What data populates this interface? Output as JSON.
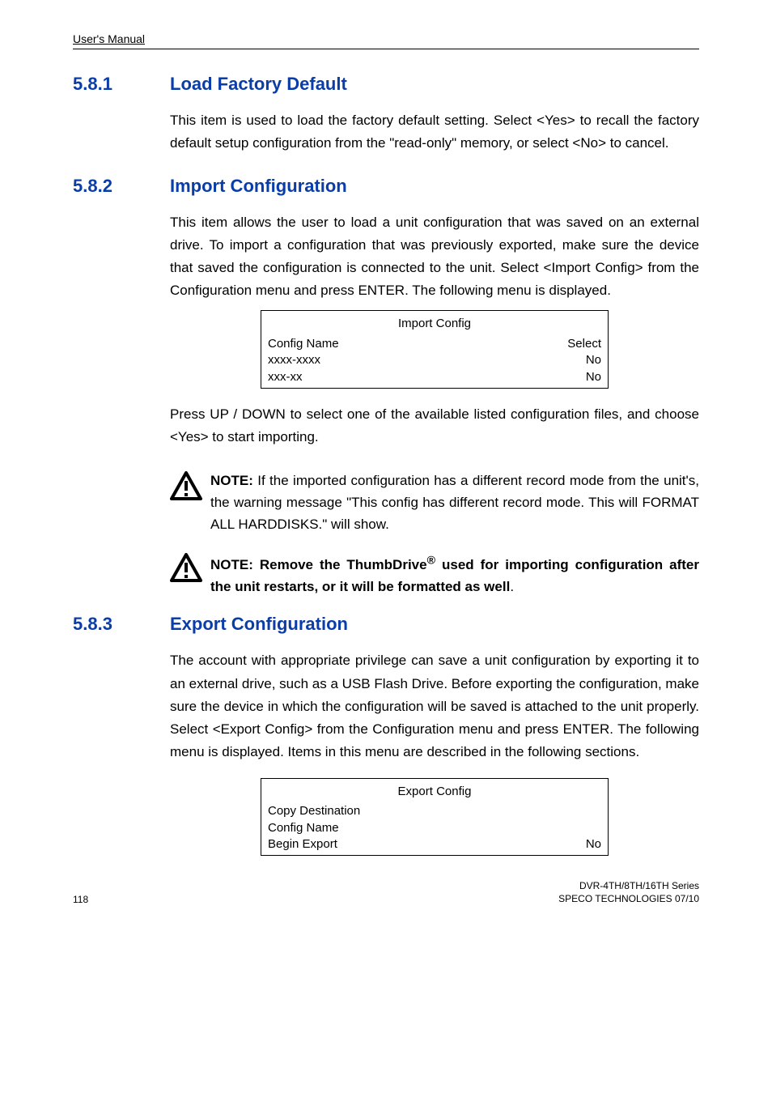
{
  "header": {
    "manual": "User's Manual"
  },
  "s581": {
    "num": "5.8.1",
    "title": "Load Factory Default",
    "body": "This item is used to load the factory default setting. Select <Yes> to recall the factory default setup configuration from the \"read-only\" memory, or select <No> to cancel."
  },
  "s582": {
    "num": "5.8.2",
    "title": "Import Configuration",
    "body1": "This item allows the user to load a unit configuration that was saved on an external drive. To import a configuration that was previously exported, make sure the device that saved the configuration is connected to the unit. Select <Import Config> from the Configuration menu and press ENTER. The following menu is displayed.",
    "table": {
      "title": "Import Config",
      "rows": [
        {
          "l": "Config Name",
          "r": "Select"
        },
        {
          "l": "xxxx-xxxx",
          "r": "No"
        },
        {
          "l": "xxx-xx",
          "r": "No"
        }
      ]
    },
    "body2": "Press UP / DOWN to select one of the available listed configuration files, and choose <Yes> to start importing.",
    "note1_label": "NOTE:",
    "note1_text": " If the imported configuration has a different record mode from the unit's, the warning message \"This config has different record mode. This will FORMAT ALL HARDDISKS.\" will show.",
    "note2_pre": "NOTE: Remove the ThumbDrive",
    "note2_post": " used for importing configuration after the unit restarts, or it will be formatted as well"
  },
  "s583": {
    "num": "5.8.3",
    "title": "Export Configuration",
    "body": "The account with appropriate privilege can save a unit configuration by exporting it to an external drive, such as a USB Flash Drive. Before exporting the configuration, make sure the device in which the configuration will be saved is attached to the unit properly. Select <Export Config> from the Configuration menu and press ENTER. The following menu is displayed. Items in this menu are described in the following sections.",
    "table": {
      "title": "Export Config",
      "rows": [
        {
          "l": "Copy Destination",
          "r": ""
        },
        {
          "l": "Config Name",
          "r": ""
        },
        {
          "l": "Begin Export",
          "r": "No"
        }
      ]
    }
  },
  "footer": {
    "page": "118",
    "series": "DVR-4TH/8TH/16TH Series",
    "company": "SPECO TECHNOLOGIES 07/10"
  }
}
